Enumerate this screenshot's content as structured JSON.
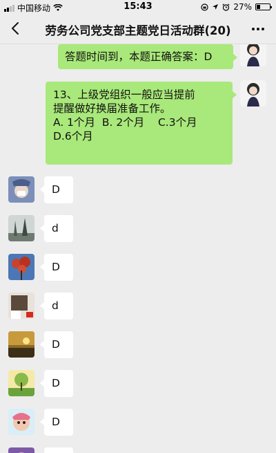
{
  "status_bar": {
    "carrier": "中国移动",
    "time": "15:43",
    "battery_percent": "27%",
    "battery_level": 0.27
  },
  "nav": {
    "title": "劳务公司党支部主题党日活动群(20)"
  },
  "messages": {
    "m1": {
      "text": "答题时间到，本题正确答案：D"
    },
    "m2": {
      "lines": [
        "13、上级党组织一般应当提前",
        "提醒做好换届准备工作。",
        "A. 1个月  B. 2个月    C.3个月",
        "D.6个月"
      ]
    },
    "replies": [
      "D",
      "d",
      "D",
      "d",
      "D",
      "D",
      "D"
    ]
  },
  "colors": {
    "background": "#ededed",
    "my_bubble": "#a9e87a",
    "their_bubble": "#ffffff"
  }
}
